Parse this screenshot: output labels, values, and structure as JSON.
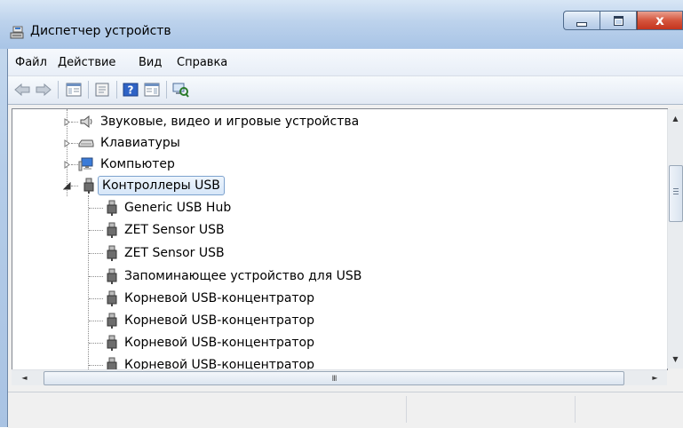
{
  "window": {
    "title": "Диспетчер устройств",
    "title_icon": "device-manager-icon",
    "close_glyph": "x",
    "accent_color": "#a9c3e3"
  },
  "menu": {
    "items": [
      "Файл",
      "Действие",
      "Вид",
      "Справка"
    ]
  },
  "toolbar": {
    "buttons": [
      {
        "icon": "back-arrow-icon"
      },
      {
        "icon": "forward-arrow-icon"
      },
      {
        "icon": "show-hide-console-tree-icon"
      },
      {
        "icon": "properties-icon"
      },
      {
        "icon": "help-icon"
      },
      {
        "icon": "action-pane-icon"
      },
      {
        "icon": "scan-hardware-changes-icon"
      }
    ]
  },
  "tree": {
    "items": [
      {
        "label": "Звуковые, видео и игровые устройства",
        "icon": "speaker-icon",
        "level": 1,
        "expanded": false
      },
      {
        "label": "Клавиатуры",
        "icon": "keyboard-icon",
        "level": 1,
        "expanded": false
      },
      {
        "label": "Компьютер",
        "icon": "computer-icon",
        "level": 1,
        "expanded": false
      },
      {
        "label": "Контроллеры USB",
        "icon": "usb-plug-icon",
        "level": 1,
        "expanded": true,
        "selected": true
      },
      {
        "label": "Generic USB Hub",
        "icon": "usb-plug-icon",
        "level": 2
      },
      {
        "label": "ZET Sensor USB",
        "icon": "usb-plug-icon",
        "level": 2
      },
      {
        "label": "ZET Sensor USB",
        "icon": "usb-plug-icon",
        "level": 2
      },
      {
        "label": "Запоминающее устройство для USB",
        "icon": "usb-plug-icon",
        "level": 2
      },
      {
        "label": "Корневой USB-концентратор",
        "icon": "usb-plug-icon",
        "level": 2
      },
      {
        "label": "Корневой USB-концентратор",
        "icon": "usb-plug-icon",
        "level": 2
      },
      {
        "label": "Корневой USB-концентратор",
        "icon": "usb-plug-icon",
        "level": 2
      },
      {
        "label": "Корневой USB-концентратор",
        "icon": "usb-plug-icon",
        "level": 2
      }
    ]
  },
  "scrollbar": {
    "h_grip": "III",
    "v_up": "▲",
    "v_down": "▼",
    "h_left": "◄",
    "h_right": "►"
  },
  "statusbar": {
    "panes": [
      "",
      "",
      ""
    ]
  }
}
